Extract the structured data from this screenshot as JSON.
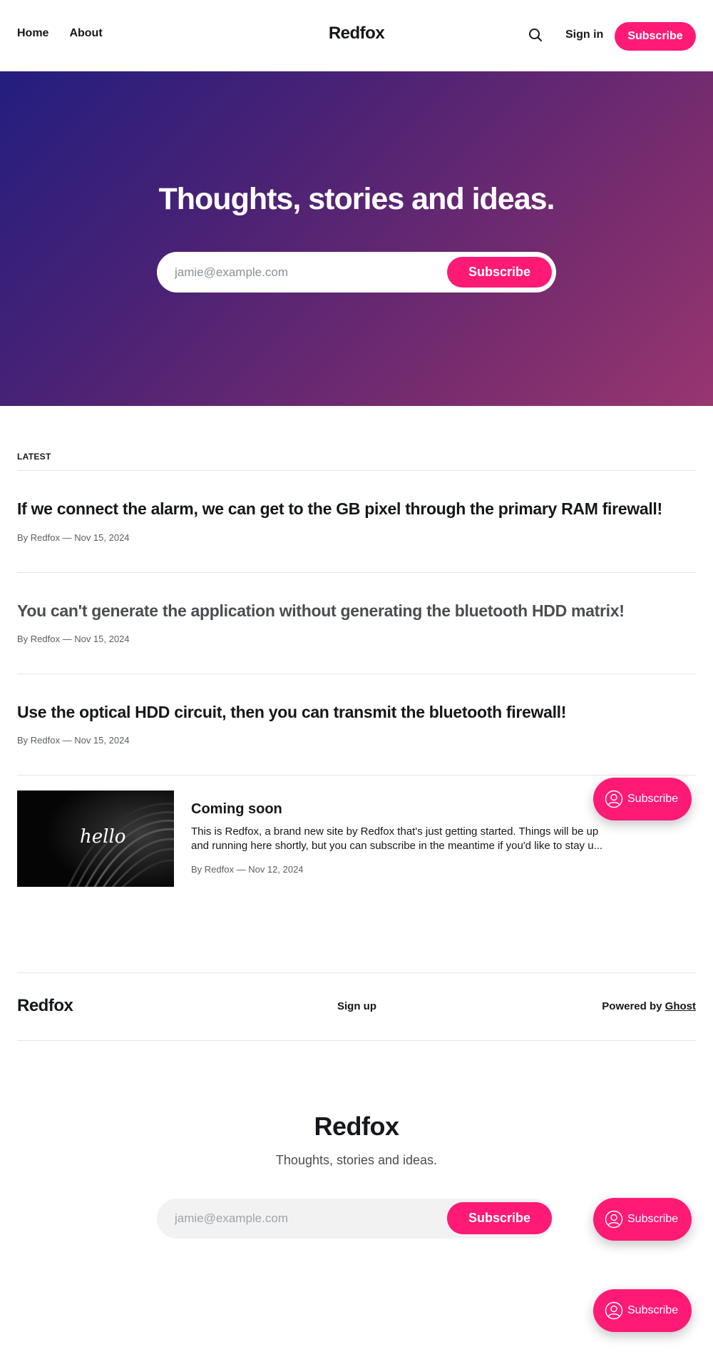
{
  "header": {
    "nav": [
      {
        "label": "Home"
      },
      {
        "label": "About"
      }
    ],
    "brand": "Redfox",
    "search_icon": "search-icon",
    "signin_label": "Sign in",
    "subscribe_label": "Subscribe"
  },
  "hero": {
    "title": "Thoughts, stories and ideas.",
    "email_placeholder": "jamie@example.com",
    "subscribe_label": "Subscribe",
    "gradient_colors": [
      "#231e7f",
      "#983670"
    ]
  },
  "latest": {
    "label": "LATEST",
    "posts": [
      {
        "title": "If we connect the alarm, we can get to the GB pixel through the primary RAM firewall!",
        "meta": "By Redfox — Nov 15, 2024"
      },
      {
        "title": "You can't generate the application without generating the bluetooth HDD matrix!",
        "meta": "By Redfox — Nov 15, 2024"
      },
      {
        "title": "Use the optical HDD circuit, then you can transmit the bluetooth firewall!",
        "meta": "By Redfox — Nov 15, 2024"
      }
    ],
    "featured": {
      "image_text": "hello",
      "title": "Coming soon",
      "excerpt": "This is Redfox, a brand new site by Redfox that's just getting started. Things will be up and running here shortly, but you can subscribe in the meantime if you'd like to stay u...",
      "meta": "By Redfox — Nov 12, 2024"
    }
  },
  "footer": {
    "brand": "Redfox",
    "signup_label": "Sign up",
    "powered_prefix": "Powered by",
    "powered_link": "Ghost"
  },
  "cta": {
    "title": "Redfox",
    "subtitle": "Thoughts, stories and ideas.",
    "email_placeholder": "jamie@example.com",
    "subscribe_label": "Subscribe"
  },
  "portal": {
    "label": "Subscribe",
    "icon": "user-icon"
  },
  "colors": {
    "accent": "#ff1a75",
    "text": "#15171a"
  }
}
